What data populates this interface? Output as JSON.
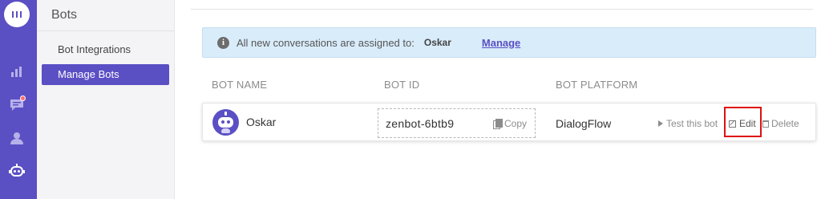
{
  "rail": {
    "items": [
      {
        "name": "logo-icon"
      },
      {
        "name": "reports-icon"
      },
      {
        "name": "conversations-icon"
      },
      {
        "name": "contacts-icon"
      },
      {
        "name": "bot-icon"
      }
    ]
  },
  "subnav": {
    "title": "Bots",
    "items": [
      {
        "label": "Bot Integrations"
      },
      {
        "label": "Manage Bots"
      }
    ]
  },
  "banner": {
    "message": "All new conversations are assigned to:",
    "assignee": "Oskar",
    "manage_label": "Manage"
  },
  "table": {
    "headers": [
      "BOT NAME",
      "BOT ID",
      "BOT PLATFORM"
    ],
    "rows": [
      {
        "name": "Oskar",
        "bot_id": "zenbot-6btb9",
        "copy_label": "Copy",
        "platform": "DialogFlow",
        "actions": {
          "test": "Test this bot",
          "edit": "Edit",
          "delete": "Delete"
        }
      }
    ]
  },
  "colors": {
    "accent": "#5b4fc4",
    "banner_bg": "#d9ecfa",
    "highlight": "#e01010"
  }
}
